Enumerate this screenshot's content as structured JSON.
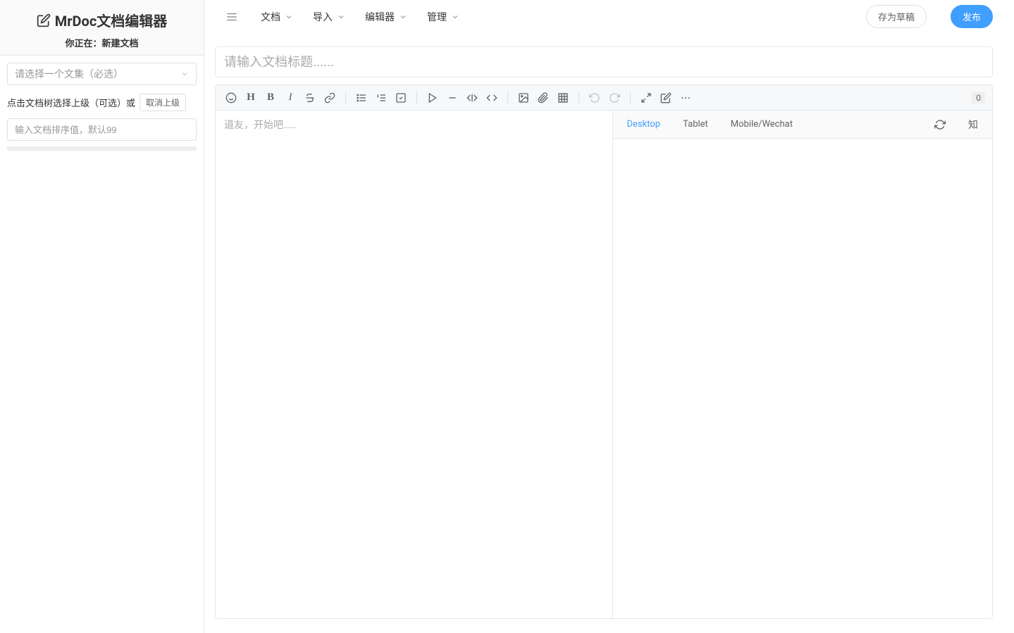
{
  "sidebar": {
    "app_title": "MrDoc文档编辑器",
    "status_prefix": "你正在：",
    "status_value": "新建文档",
    "collection_placeholder": "请选择一个文集（必选）",
    "tree_label": "点击文档树选择上级（可选）或",
    "cancel_parent_btn": "取消上级",
    "sort_placeholder": "输入文档排序值，默认99"
  },
  "menu": {
    "items": [
      {
        "label": "文档"
      },
      {
        "label": "导入"
      },
      {
        "label": "编辑器"
      },
      {
        "label": "管理"
      }
    ]
  },
  "actions": {
    "save_draft": "存为草稿",
    "publish": "发布"
  },
  "editor": {
    "title_placeholder": "请输入文档标题......",
    "body_placeholder": "道友，开始吧……",
    "word_count": "0"
  },
  "preview": {
    "tabs": [
      {
        "label": "Desktop",
        "active": true
      },
      {
        "label": "Tablet",
        "active": false
      },
      {
        "label": "Mobile/Wechat",
        "active": false
      }
    ],
    "zhi_label": "知"
  }
}
